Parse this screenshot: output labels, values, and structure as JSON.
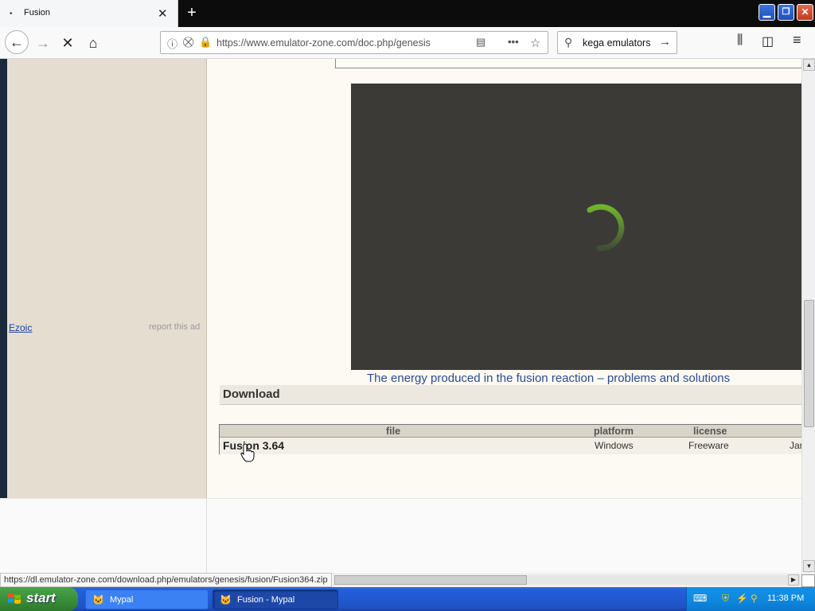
{
  "browser": {
    "tab_title": "Fusion",
    "tab_favicon": "•",
    "tab_close": "✕",
    "new_tab": "+",
    "url": "https://www.emulator-zone.com/doc.php/genesis",
    "search_value": "kega emulators",
    "status_url": "https://dl.emulator-zone.com/download.php/emulators/genesis/fusion/Fusion364.zip"
  },
  "page": {
    "ezoic": "Ezoic",
    "report_ad": "report this ad",
    "article_link": "The energy produced in the fusion reaction – problems and solutions",
    "download_heading": "Download",
    "table": {
      "headers": [
        "file",
        "platform",
        "license"
      ],
      "rows": [
        {
          "file": "Fusion 3.64",
          "platform": "Windows",
          "license": "Freeware",
          "extra": "Jan"
        }
      ]
    }
  },
  "taskbar": {
    "start": "start",
    "tasks": [
      {
        "label": "Mypal"
      },
      {
        "label": "Fusion - Mypal"
      }
    ],
    "clock": "11:38 PM"
  },
  "colors": {
    "video_bg": "#3c3a36",
    "spinner": "#6fb52c",
    "link": "#2a4a9a"
  }
}
